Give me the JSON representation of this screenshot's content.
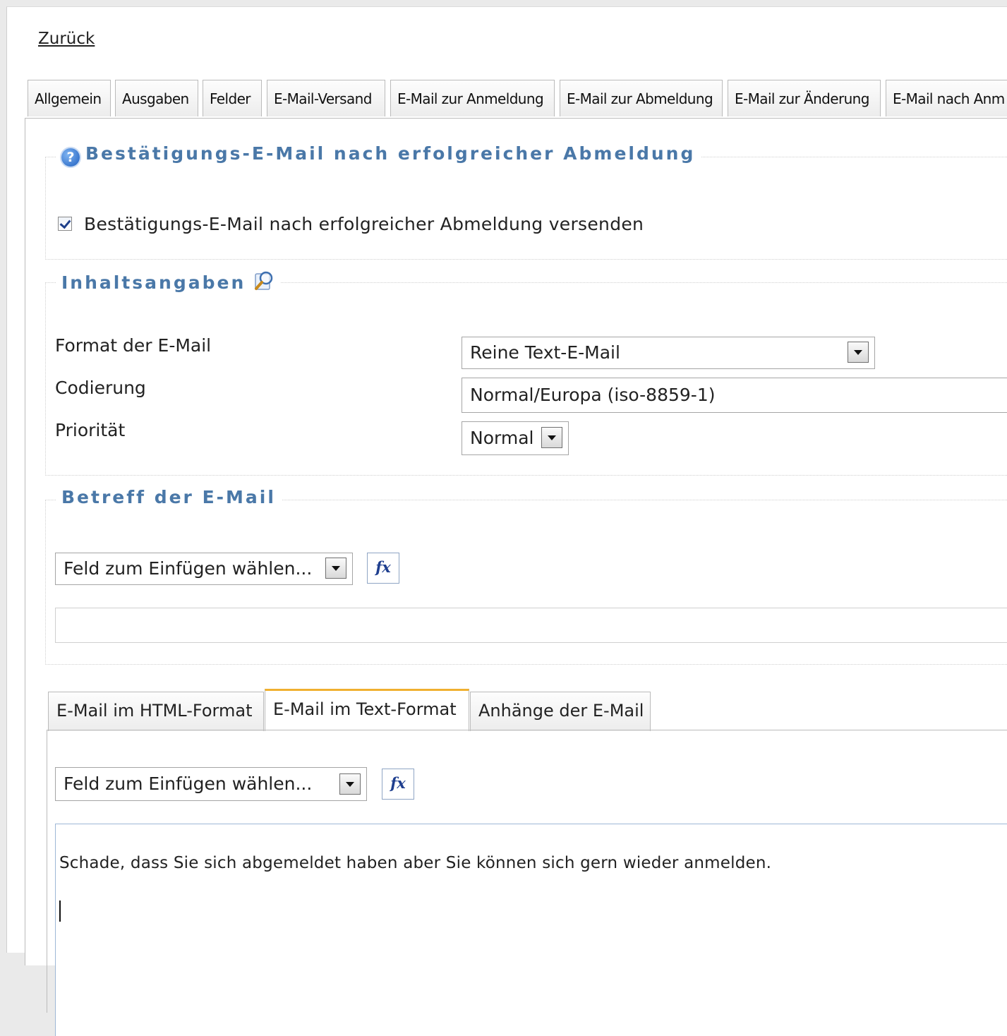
{
  "nav": {
    "back_label": "Zurück"
  },
  "top_tabs": [
    "Allgemein",
    "Ausgaben",
    "Felder",
    "E-Mail-Versand",
    "E-Mail zur Anmeldung",
    "E-Mail zur Abmeldung",
    "E-Mail zur Änderung",
    "E-Mail nach Anm"
  ],
  "confirmation": {
    "legend": "Bestätigungs-E-Mail nach erfolgreicher Abmeldung",
    "checkbox_label": "Bestätigungs-E-Mail nach erfolgreicher Abmeldung versenden",
    "checked": true
  },
  "content": {
    "legend": "Inhaltsangaben",
    "format_label": "Format der E-Mail",
    "format_value": "Reine Text-E-Mail",
    "encoding_label": "Codierung",
    "encoding_value": "Normal/Europa (iso-8859-1)",
    "priority_label": "Priorität",
    "priority_value": "Normal"
  },
  "subject": {
    "legend": "Betreff der E-Mail",
    "field_select": "Feld zum Einfügen wählen...",
    "fx_label": "fx",
    "value": ""
  },
  "body_tabs": [
    "E-Mail im HTML-Format",
    "E-Mail im Text-Format",
    "Anhänge der E-Mail"
  ],
  "body": {
    "active_tab": "E-Mail im Text-Format",
    "field_select": "Feld zum Einfügen wählen...",
    "fx_label": "fx",
    "text": "Schade, dass Sie sich abgemeldet haben aber Sie können sich gern wieder anmelden."
  },
  "colors": {
    "legend": "#4a78a8",
    "active_tab_accent": "#f0b030"
  },
  "icons": [
    "help-icon",
    "magnifier-icon",
    "chevron-down-icon",
    "fx-icon"
  ]
}
